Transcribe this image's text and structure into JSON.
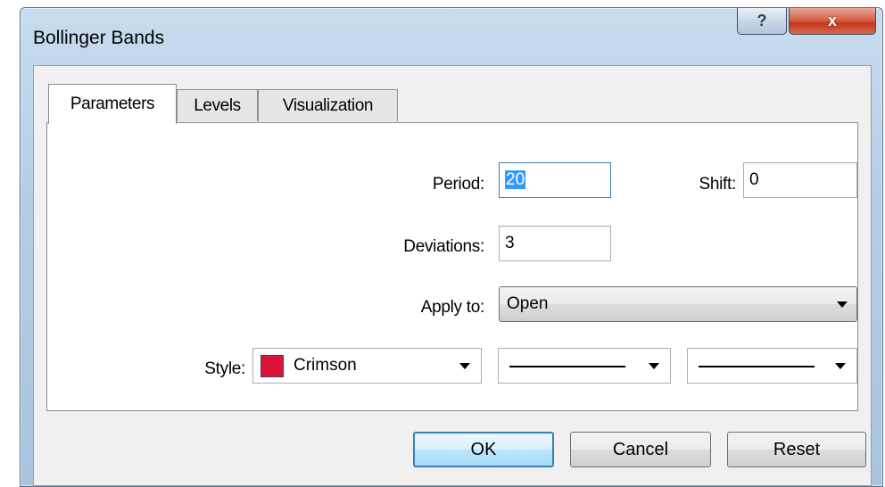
{
  "window": {
    "title": "Bollinger Bands",
    "help_label": "?",
    "close_label": "x"
  },
  "tabs": [
    {
      "label": "Parameters",
      "active": true
    },
    {
      "label": "Levels",
      "active": false
    },
    {
      "label": "Visualization",
      "active": false
    }
  ],
  "parameters": {
    "period": {
      "label": "Period:",
      "value": "20"
    },
    "shift": {
      "label": "Shift:",
      "value": "0"
    },
    "deviations": {
      "label": "Deviations:",
      "value": "3"
    },
    "apply_to": {
      "label": "Apply to:",
      "value": "Open"
    },
    "style": {
      "label": "Style:",
      "color_name": "Crimson",
      "color_hex": "#dc143c",
      "line_style": "solid",
      "line_width": "thin"
    }
  },
  "buttons": {
    "ok": "OK",
    "cancel": "Cancel",
    "reset": "Reset"
  },
  "colors": {
    "selection": "#3399ff",
    "focus_border": "#3c7fb1",
    "close_button": "#c4381d"
  }
}
